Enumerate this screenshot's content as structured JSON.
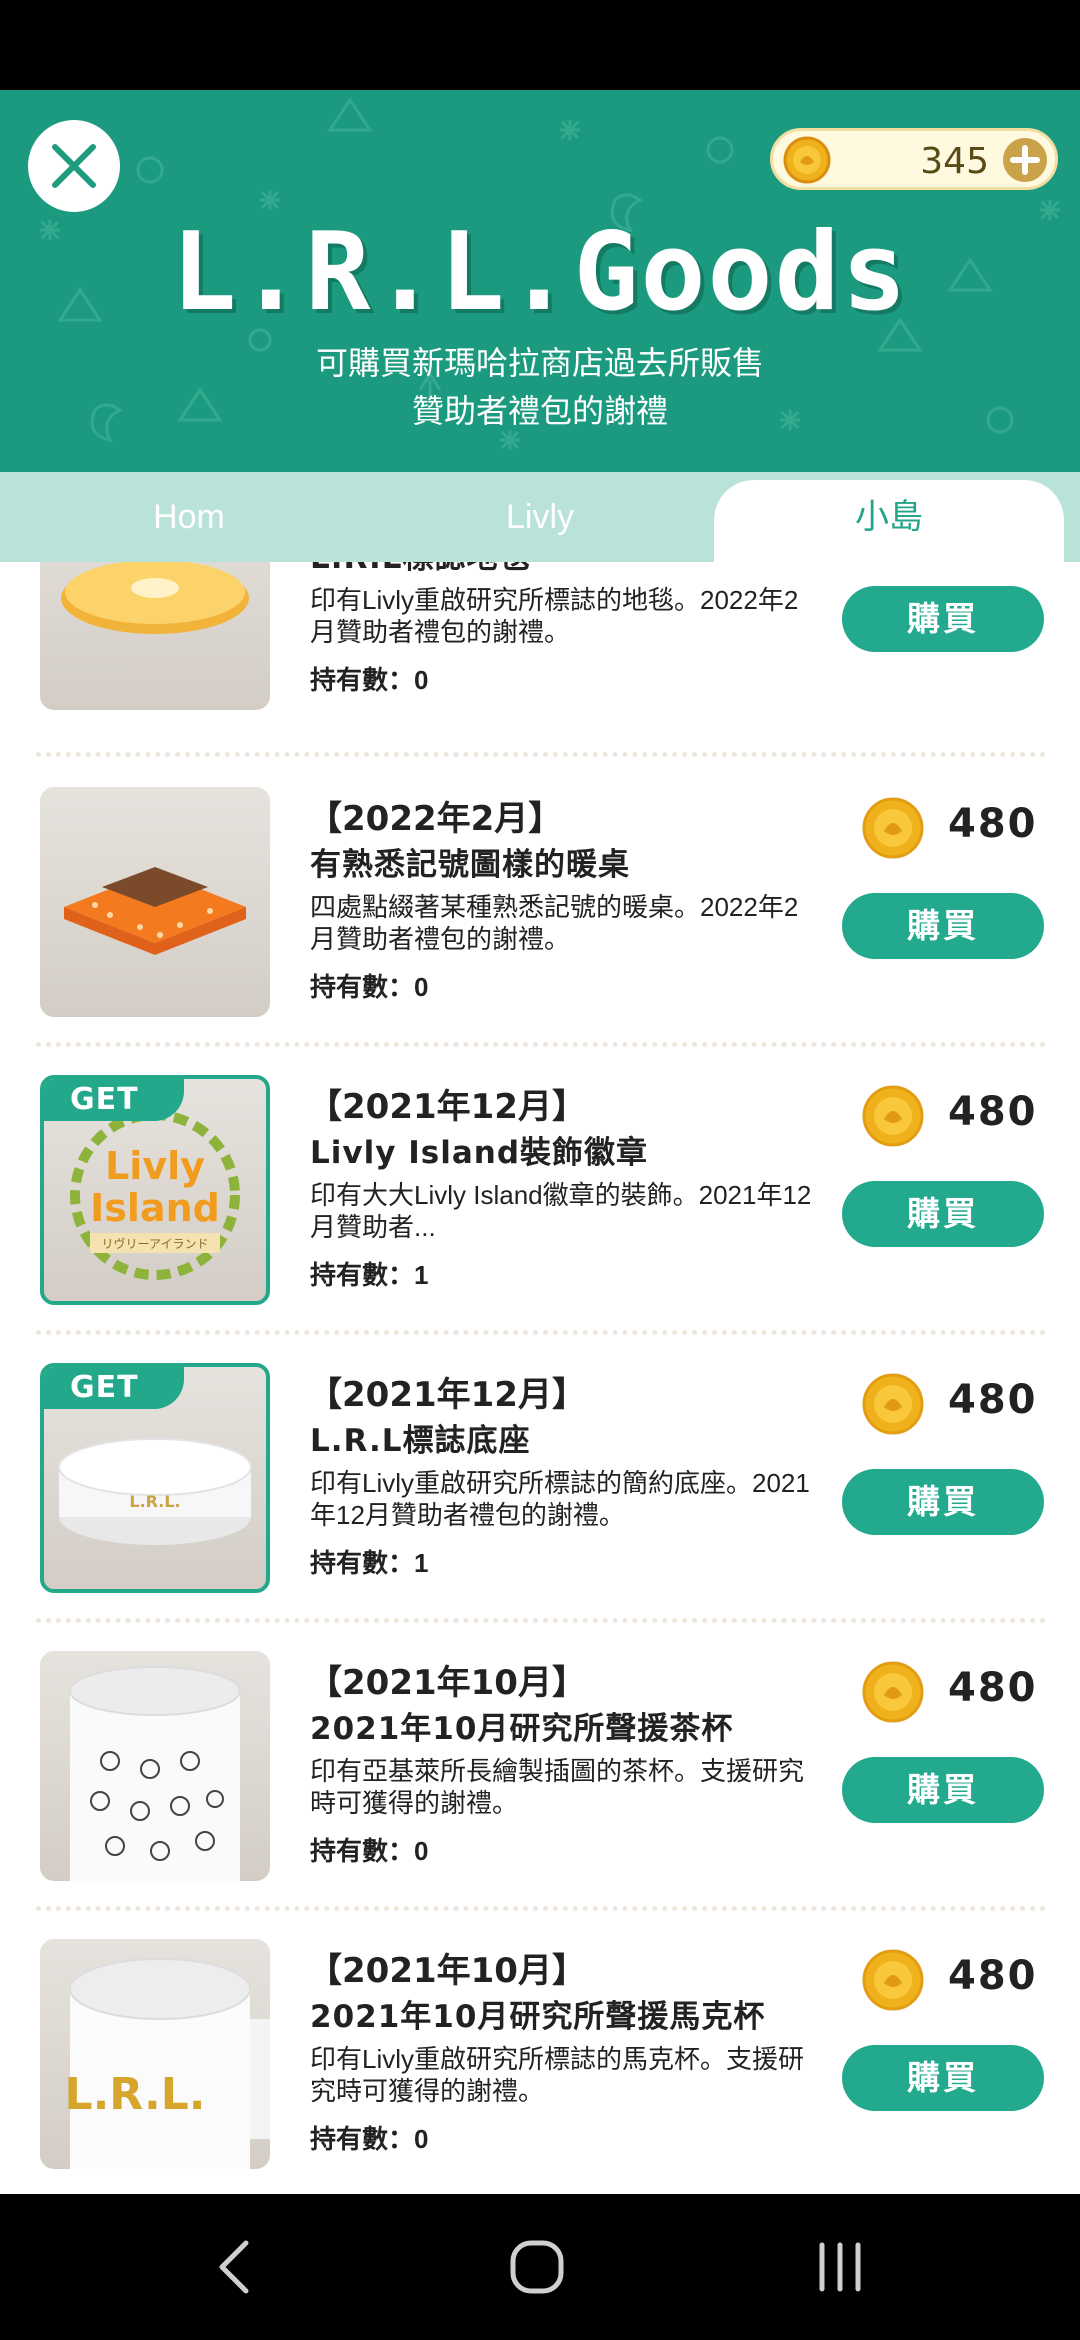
{
  "header": {
    "logo_text": "L.R.L.Goods",
    "subtitle_line1": "可購買新瑪哈拉商店過去所販售",
    "subtitle_line2": "贊助者禮包的謝禮",
    "coin_count": "345",
    "accent_color": "#1b9a7f"
  },
  "tabs": [
    {
      "label": "Hom",
      "active": false
    },
    {
      "label": "Livly",
      "active": false
    },
    {
      "label": "小島",
      "active": true
    }
  ],
  "items": [
    {
      "date": "",
      "name": "L.R.L標誌地毯",
      "desc": "印有Livly重啟研究所標誌的地毯。2022年2月贊助者禮包的謝禮。",
      "owned": "持有數：0",
      "price": "",
      "buy_label": "購買",
      "got": false
    },
    {
      "date": "【2022年2月】",
      "name": "有熟悉記號圖樣的暖桌",
      "desc": "四處點綴著某種熟悉記號的暖桌。2022年2月贊助者禮包的謝禮。",
      "owned": "持有數：0",
      "price": "480",
      "buy_label": "購買",
      "got": false
    },
    {
      "date": "【2021年12月】",
      "name": "Livly Island裝飾徽章",
      "desc": "印有大大Livly Island徽章的裝飾。2021年12月贊助者...",
      "owned": "持有數：1",
      "price": "480",
      "buy_label": "購買",
      "got": true,
      "badge": "GET"
    },
    {
      "date": "【2021年12月】",
      "name": "L.R.L標誌底座",
      "desc": "印有Livly重啟研究所標誌的簡約底座。2021年12月贊助者禮包的謝禮。",
      "owned": "持有數：1",
      "price": "480",
      "buy_label": "購買",
      "got": true,
      "badge": "GET"
    },
    {
      "date": "【2021年10月】",
      "name": "2021年10月研究所聲援茶杯",
      "desc": "印有亞基萊所長繪製插圖的茶杯。支援研究時可獲得的謝禮。",
      "owned": "持有數：0",
      "price": "480",
      "buy_label": "購買",
      "got": false
    },
    {
      "date": "【2021年10月】",
      "name": "2021年10月研究所聲援馬克杯",
      "desc": "印有Livly重啟研究所標誌的馬克杯。支援研究時可獲得的謝禮。",
      "owned": "持有數：0",
      "price": "480",
      "buy_label": "購買",
      "got": false
    }
  ],
  "thumbnail_texts": {
    "badge_livly": "Livly",
    "badge_island": "Island",
    "badge_ribbon": "リヴリーアイランド",
    "base_logo": "L.R.L.",
    "mug_logo": "L.R.L."
  },
  "icons": {
    "close": "close-icon",
    "coin": "coin-icon",
    "plus": "plus-icon",
    "nav_back": "back-icon",
    "nav_home": "home-icon",
    "nav_recents": "recents-icon"
  }
}
